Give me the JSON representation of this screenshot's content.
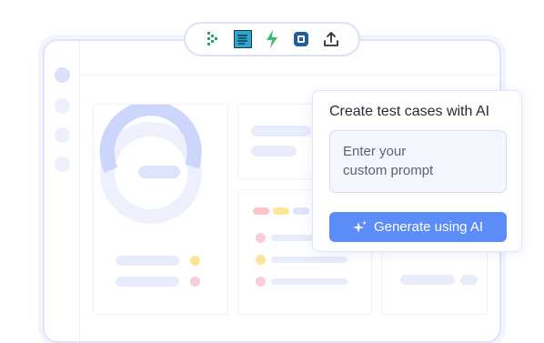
{
  "toolbar": {
    "icons": [
      "jira-icon",
      "testrail-icon",
      "bolt-icon",
      "qase-icon",
      "upload-icon"
    ]
  },
  "popup": {
    "title": "Create test cases with AI",
    "prompt_placeholder": "Enter your\ncustom prompt",
    "generate_label": "Generate using AI"
  },
  "colors": {
    "accent": "#5b8cf8",
    "popup_border": "#dde3fb",
    "field_bg": "#f4f6fe",
    "mock_line": "#e8ebfa",
    "mock_yellow": "#fbe698",
    "mock_pink": "#f6cfdb",
    "mock_red": "#f7c4c9",
    "chart_ring": "#ccd5fb"
  }
}
